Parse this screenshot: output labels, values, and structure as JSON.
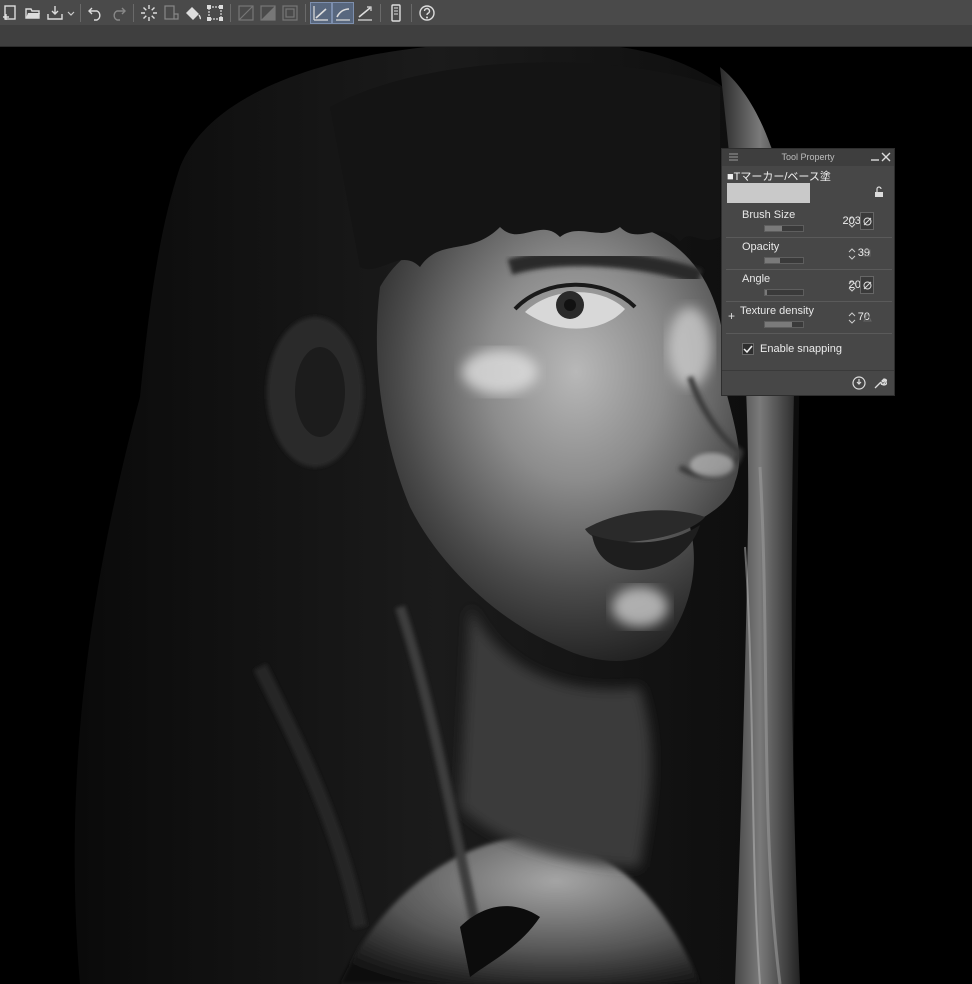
{
  "toolbar": {
    "icons": [
      "new-icon",
      "open-icon",
      "save-icon",
      "dropdown-icon",
      "undo-icon",
      "redo-icon",
      "loading-icon",
      "clear-icon",
      "fill-icon",
      "transform-icon",
      "hide-selection-icon",
      "tone-icon",
      "border-icon",
      "snap-ruler-icon",
      "snap-special-ruler-icon",
      "snap-grid-icon",
      "smartphone-icon",
      "help-icon"
    ]
  },
  "tool_property": {
    "title": "Tool Property",
    "preset_name": "■Tマーカー/ベース塗",
    "properties": [
      {
        "label": "Brush Size",
        "value": "203.5",
        "slider_fraction": 0.45,
        "has_button": true
      },
      {
        "label": "Opacity",
        "value": "39",
        "slider_fraction": 0.39,
        "has_button": false
      },
      {
        "label": "Angle",
        "value": "20.0",
        "slider_fraction": 0.05,
        "has_button": true
      },
      {
        "label": "Texture density",
        "value": "70",
        "slider_fraction": 0.7,
        "has_button": false
      }
    ],
    "snapping_label": "Enable snapping",
    "snapping_checked": true
  }
}
